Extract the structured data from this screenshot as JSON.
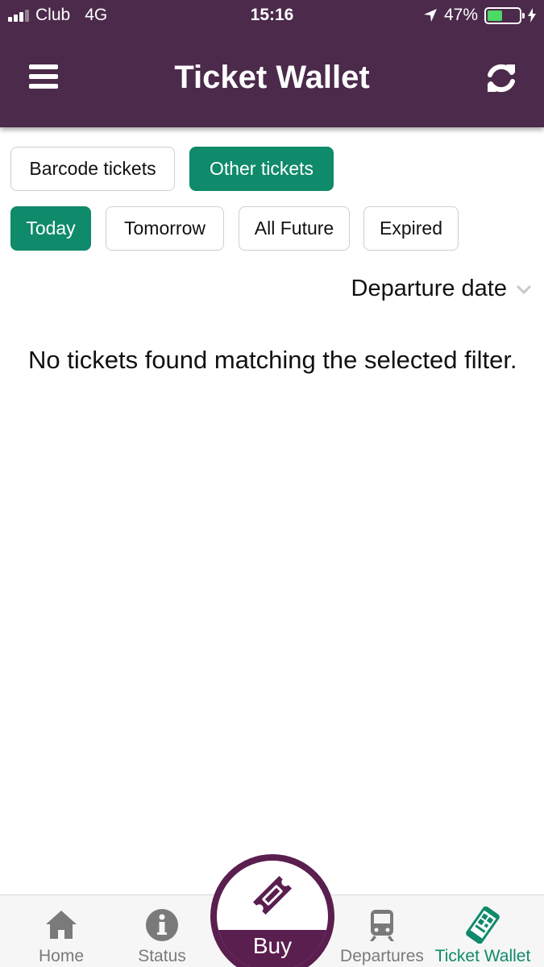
{
  "status_bar": {
    "carrier": "Club",
    "network": "4G",
    "time": "15:16",
    "battery_percent": "47%",
    "battery_level": 0.47
  },
  "header": {
    "title": "Ticket Wallet"
  },
  "ticket_type_tabs": [
    {
      "label": "Barcode tickets",
      "active": false
    },
    {
      "label": "Other tickets",
      "active": true
    }
  ],
  "date_filters": [
    {
      "label": "Today",
      "active": true
    },
    {
      "label": "Tomorrow",
      "active": false
    },
    {
      "label": "All Future",
      "active": false
    },
    {
      "label": "Expired",
      "active": false
    }
  ],
  "sort": {
    "label": "Departure date"
  },
  "empty_message": "No tickets found matching the selected filter.",
  "bottom_nav": {
    "home": "Home",
    "status": "Status",
    "buy": "Buy",
    "departures": "Departures",
    "ticket_wallet": "Ticket Wallet"
  },
  "colors": {
    "header_purple": "#4b2a4b",
    "accent_green": "#0f8a6b",
    "buy_purple": "#5a1e4f"
  }
}
